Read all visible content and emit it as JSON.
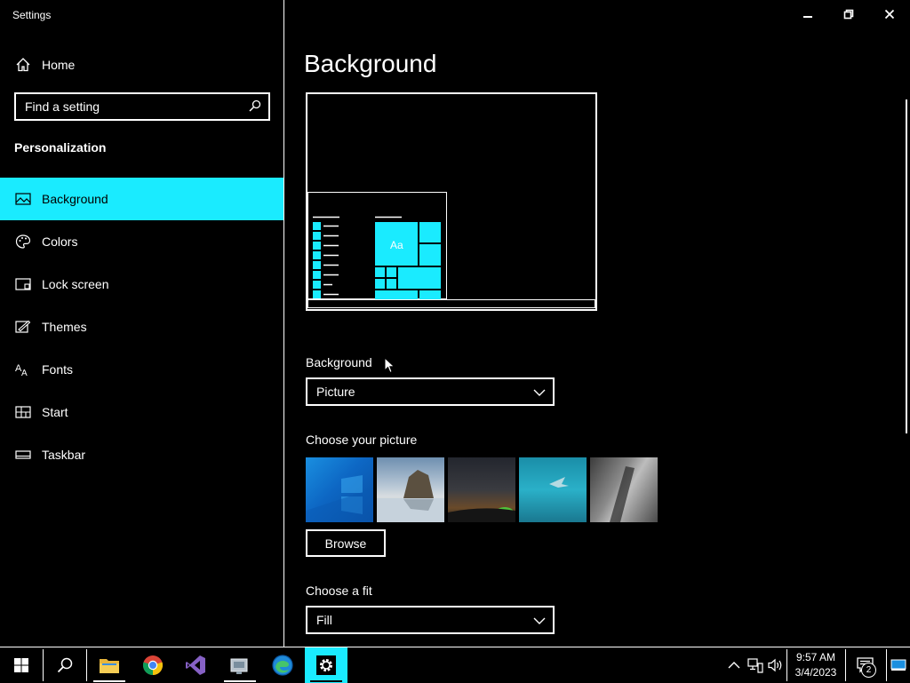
{
  "window": {
    "title": "Settings",
    "minimize_icon": "minimize-icon",
    "restore_icon": "restore-icon",
    "close_icon": "close-icon"
  },
  "sidebar": {
    "home_label": "Home",
    "search_placeholder": "Find a setting",
    "section_title": "Personalization",
    "items": [
      {
        "label": "Background",
        "icon": "picture-icon",
        "selected": true
      },
      {
        "label": "Colors",
        "icon": "palette-icon"
      },
      {
        "label": "Lock screen",
        "icon": "lock-screen-icon"
      },
      {
        "label": "Themes",
        "icon": "brush-icon"
      },
      {
        "label": "Fonts",
        "icon": "font-icon"
      },
      {
        "label": "Start",
        "icon": "start-icon"
      },
      {
        "label": "Taskbar",
        "icon": "taskbar-icon"
      }
    ]
  },
  "main": {
    "title": "Background",
    "preview_tile_text": "Aa",
    "background_label": "Background",
    "background_value": "Picture",
    "choose_picture_label": "Choose your picture",
    "browse_label": "Browse",
    "fit_label": "Choose a fit",
    "fit_value": "Fill"
  },
  "taskbar": {
    "clock_time": "9:57 AM",
    "clock_date": "3/4/2023",
    "notification_count": "2"
  },
  "colors": {
    "accent": "#1aebff",
    "background": "#000000",
    "foreground": "#ffffff"
  }
}
